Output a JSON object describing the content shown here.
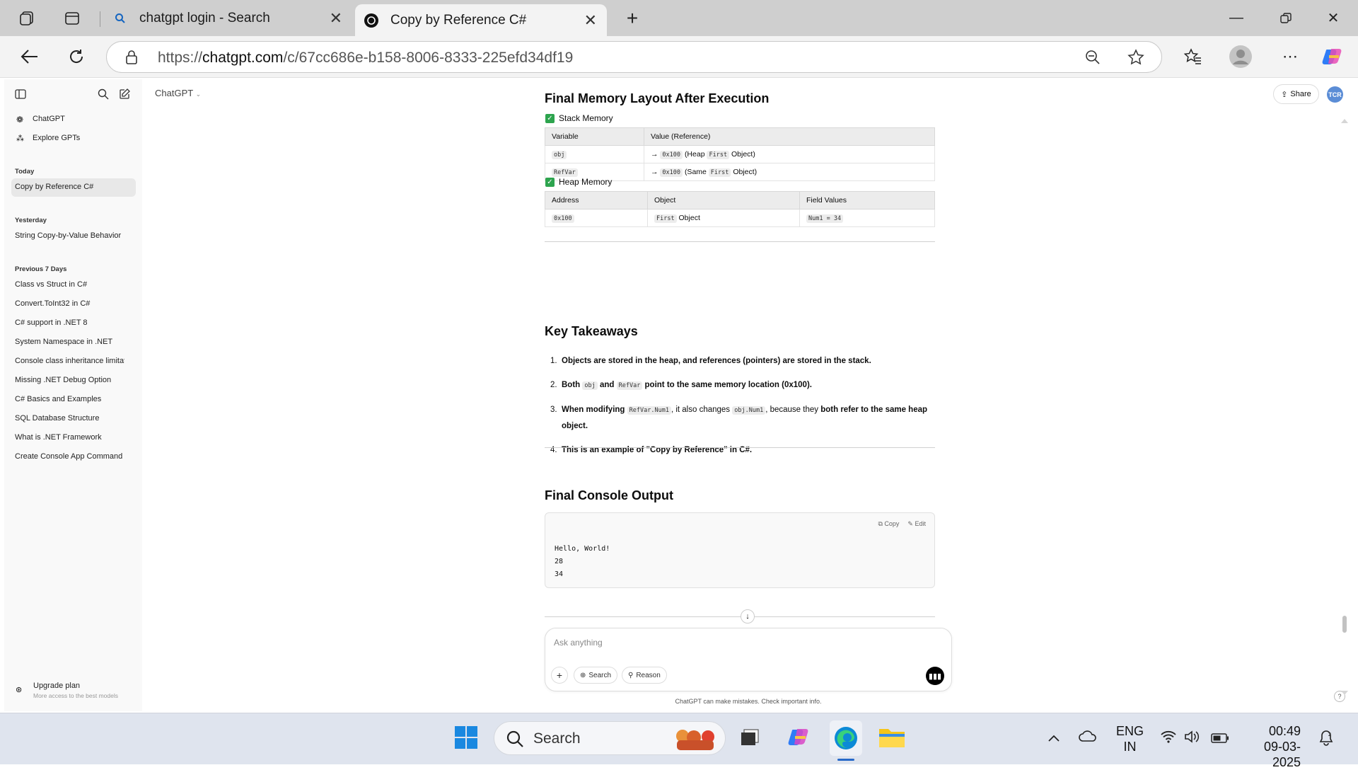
{
  "browser": {
    "tabs": [
      {
        "title": "chatgpt login - Search",
        "active": false
      },
      {
        "title": "Copy by Reference C#",
        "active": true
      }
    ],
    "url_prefix": "https://",
    "url_host": "chatgpt.com",
    "url_path": "/c/67cc686e-b158-8006-8333-225efd34df19"
  },
  "sidebar": {
    "top_items": [
      "ChatGPT",
      "Explore GPTs"
    ],
    "today_label": "Today",
    "today_items": [
      "Copy by Reference C#"
    ],
    "yesterday_label": "Yesterday",
    "yesterday_items": [
      "String Copy-by-Value Behavior"
    ],
    "prev7_label": "Previous 7 Days",
    "prev7_items": [
      "Class vs Struct in C#",
      "Convert.ToInt32 in C#",
      "C# support in .NET 8",
      "System Namespace in .NET",
      "Console class inheritance limitat",
      "Missing .NET Debug Option",
      "C# Basics and Examples",
      "SQL Database Structure",
      "What is .NET Framework",
      "Create Console App Command"
    ],
    "upgrade_title": "Upgrade plan",
    "upgrade_sub": "More access to the best models"
  },
  "header": {
    "model": "ChatGPT",
    "share": "Share",
    "avatar": "TCR"
  },
  "content": {
    "memory_heading": "Final Memory Layout After Execution",
    "stack_label": "Stack Memory",
    "stack_table": {
      "headers": [
        "Variable",
        "Value (Reference)"
      ],
      "rows": [
        {
          "var": "obj",
          "arrow": "→",
          "addr": "0x100",
          "pre": "(Heap",
          "cls": "First",
          "post": "Object)"
        },
        {
          "var": "RefVar",
          "arrow": "→",
          "addr": "0x100",
          "pre": "(Same",
          "cls": "First",
          "post": "Object)"
        }
      ]
    },
    "heap_label": "Heap Memory",
    "heap_table": {
      "headers": [
        "Address",
        "Object",
        "Field Values"
      ],
      "rows": [
        {
          "addr": "0x100",
          "cls": "First",
          "obj": "Object",
          "fields": "Num1 = 34"
        }
      ]
    },
    "takeaways_heading": "Key Takeaways",
    "takeaways": {
      "t1": "Objects are stored in the heap, and references (pointers) are stored in the stack.",
      "t2a": "Both",
      "t2_code1": "obj",
      "t2b": "and",
      "t2_code2": "RefVar",
      "t2c": "point to the same memory location (0x100).",
      "t3a": "When modifying",
      "t3_code1": "RefVar.Num1",
      "t3b": ", it also changes",
      "t3_code2": "obj.Num1",
      "t3c": ", because they",
      "t3d": "both refer to the same heap object.",
      "t4": "This is an example of \"Copy by Reference\" in C#."
    },
    "console_heading": "Final Console Output",
    "code_copy": "Copy",
    "code_edit": "Edit",
    "console_lines": [
      "Hello, World!",
      "28",
      "34"
    ]
  },
  "composer": {
    "placeholder": "Ask anything",
    "search": "Search",
    "reason": "Reason",
    "disclaimer": "ChatGPT can make mistakes. Check important info."
  },
  "taskbar": {
    "search": "Search",
    "lang1": "ENG",
    "lang2": "IN",
    "time": "00:49",
    "date": "09-03-2025"
  }
}
